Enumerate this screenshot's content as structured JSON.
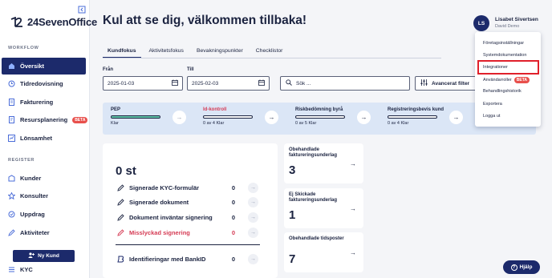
{
  "app": {
    "name": "24SevenOffice"
  },
  "sidebar": {
    "workflow_label": "WORKFLOW",
    "register_label": "REGISTER",
    "workflow_items": [
      {
        "label": "Översikt",
        "icon": "home-icon",
        "active": true
      },
      {
        "label": "Tidredovisning",
        "icon": "clock-icon"
      },
      {
        "label": "Fakturering",
        "icon": "invoice-icon"
      },
      {
        "label": "Resursplanering",
        "icon": "resource-icon",
        "badge": "BETA"
      },
      {
        "label": "Lönsamhet",
        "icon": "chart-icon"
      }
    ],
    "register_items": [
      {
        "label": "Kunder",
        "icon": "customers-icon"
      },
      {
        "label": "Konsulter",
        "icon": "consultants-icon"
      },
      {
        "label": "Uppdrag",
        "icon": "assignments-icon"
      },
      {
        "label": "Aktiviteter",
        "icon": "activities-icon"
      },
      {
        "label": "KYC",
        "icon": "kyc-icon"
      }
    ],
    "new_customer_label": "Ny Kund"
  },
  "header": {
    "welcome": "Kul att se dig, välkommen tillbaka!",
    "user": {
      "initials": "LS",
      "name": "Lisabet Sivertsen",
      "org": "David Demo"
    }
  },
  "tabs": [
    {
      "label": "Kundfokus",
      "active": true
    },
    {
      "label": "Aktivitetsfokus"
    },
    {
      "label": "Bevakningspunkter"
    },
    {
      "label": "Checklistor"
    }
  ],
  "filters": {
    "from_label": "Från",
    "from_value": "2025-01-03",
    "to_label": "Till",
    "to_value": "2025-02-03",
    "search_placeholder": "Sök ...",
    "advanced_label": "Avancerat filter"
  },
  "progress_steps": [
    {
      "title": "PEP",
      "sub": "Klar",
      "fill": 1.0,
      "warn": false
    },
    {
      "title": "Id-kontroll",
      "sub": "0 av 4 Klar",
      "fill": 0.0,
      "warn": true
    },
    {
      "title": "Riskbedömning byrå",
      "sub": "0 av 5 Klar",
      "fill": 0.0,
      "warn": false
    },
    {
      "title": "Registreringsbevis kund",
      "sub": "0 av 4 Klar",
      "fill": 0.0,
      "warn": false
    }
  ],
  "stats": {
    "count": "0 st",
    "rows": [
      {
        "label": "Signerade KYC-formulär",
        "value": "0",
        "icon": "pen-icon"
      },
      {
        "label": "Signerade dokument",
        "value": "0",
        "icon": "pen-icon"
      },
      {
        "label": "Dokument inväntar signering",
        "value": "0",
        "icon": "pen-icon"
      },
      {
        "label": "Misslyckad signering",
        "value": "0",
        "icon": "pen-icon",
        "warn": true
      }
    ],
    "bankid_row": {
      "label": "Identifieringar med BankID",
      "value": "0",
      "icon": "bankid-icon"
    }
  },
  "tiles": [
    {
      "title": "Obehandlade faktureringsunderlag",
      "value": "3"
    },
    {
      "title": "Ej Skickade faktureringsunderlag",
      "value": "1"
    },
    {
      "title": "Obehandlade tidsposter",
      "value": "7"
    }
  ],
  "menu": {
    "items": [
      {
        "label": "Företagsinställningar"
      },
      {
        "label": "Systemdokumentation"
      },
      {
        "label": "Integrationer",
        "highlighted": true
      },
      {
        "label": "Användarroller",
        "badge": "BETA"
      },
      {
        "label": "Behandlingshistorik"
      },
      {
        "label": "Exportera"
      },
      {
        "label": "Logga ut"
      }
    ]
  },
  "help_label": "Hjälp",
  "colors": {
    "brand": "#1c2a6b",
    "beta": "#e8504c",
    "progress": "#5fc4a8",
    "warn": "#d53b54",
    "highlight": "#e0202b",
    "band": "#dbe6f6"
  }
}
